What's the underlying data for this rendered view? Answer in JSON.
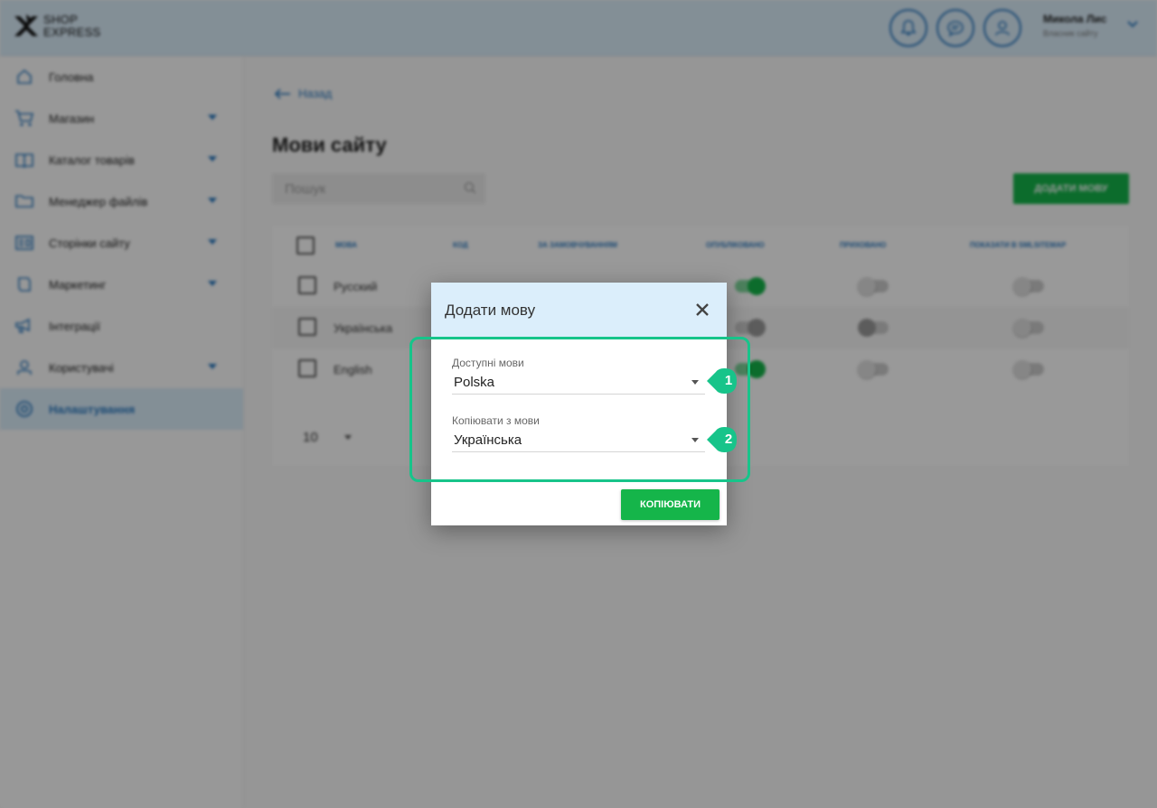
{
  "header": {
    "logo_line1": "SHOP",
    "logo_line2": "EXPRESS",
    "user_name": "Микола Лис",
    "user_role": "Власник сайту"
  },
  "sidebar": {
    "items": [
      {
        "label": "Головна",
        "icon": "home-icon",
        "has_caret": false
      },
      {
        "label": "Магазин",
        "icon": "cart-icon",
        "has_caret": true
      },
      {
        "label": "Каталог товарів",
        "icon": "book-icon",
        "has_caret": true
      },
      {
        "label": "Менеджер файлів",
        "icon": "folder-icon",
        "has_caret": true
      },
      {
        "label": "Сторінки сайту",
        "icon": "pages-icon",
        "has_caret": true
      },
      {
        "label": "Маркетинг",
        "icon": "marketing-icon",
        "has_caret": true
      },
      {
        "label": "Інтеграції",
        "icon": "megaphone-icon",
        "has_caret": false
      },
      {
        "label": "Користувачі",
        "icon": "user-icon",
        "has_caret": true
      },
      {
        "label": "Налаштування",
        "icon": "gear-icon",
        "has_caret": false,
        "active": true
      }
    ]
  },
  "main": {
    "back_label": "Назад",
    "title": "Мови сайту",
    "search_placeholder": "Пошук",
    "add_button": "ДОДАТИ МОВУ",
    "table": {
      "columns": [
        "МОВА",
        "КОД",
        "ЗА ЗАМОВЧУВАННЯМ",
        "ОПУБЛІКОВАНО",
        "ПРИХОВАНО",
        "ПОКАЗАТИ В SMLSITEMAP"
      ],
      "rows": [
        {
          "language": "Русский",
          "published": "on",
          "hidden": "offlight",
          "sitemap": "offlight"
        },
        {
          "language": "Українська",
          "published": "off",
          "hidden": "off",
          "sitemap": "offlight"
        },
        {
          "language": "English",
          "published": "on",
          "hidden": "offlight",
          "sitemap": "offlight"
        }
      ]
    },
    "per_page": "10"
  },
  "dialog": {
    "title": "Додати мову",
    "field1": {
      "label": "Доступні мови",
      "value": "Polska"
    },
    "field2": {
      "label": "Копіювати з мови",
      "value": "Українська"
    },
    "copy_button": "КОПІЮВАТИ"
  },
  "annotations": {
    "marker1": "1",
    "marker2": "2",
    "highlight_color": "#17c48a"
  },
  "colors": {
    "accent": "#2a79c0",
    "primary_button": "#15b54a",
    "header_bg": "#dbeefb"
  }
}
